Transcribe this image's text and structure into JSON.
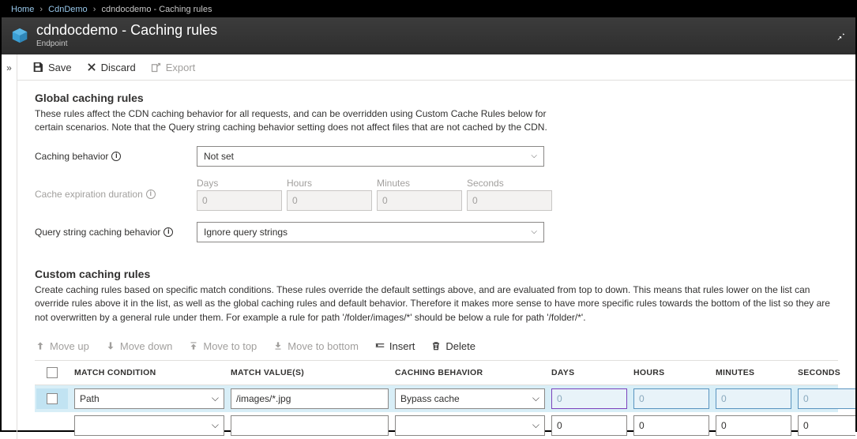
{
  "breadcrumb": {
    "home": "Home",
    "profile": "CdnDemo",
    "current": "cdndocdemo - Caching rules"
  },
  "header": {
    "title": "cdndocdemo - Caching rules",
    "subtitle": "Endpoint"
  },
  "toolbar": {
    "save": "Save",
    "discard": "Discard",
    "export": "Export"
  },
  "global": {
    "heading": "Global caching rules",
    "desc": "These rules affect the CDN caching behavior for all requests, and can be overridden using Custom Cache Rules below for certain scenarios. Note that the Query string caching behavior setting does not affect files that are not cached by the CDN.",
    "caching_label": "Caching behavior",
    "caching_value": "Not set",
    "duration_label": "Cache expiration duration",
    "d_days": "Days",
    "d_hours": "Hours",
    "d_minutes": "Minutes",
    "d_seconds": "Seconds",
    "d_days_v": "0",
    "d_hours_v": "0",
    "d_minutes_v": "0",
    "d_seconds_v": "0",
    "query_label": "Query string caching behavior",
    "query_value": "Ignore query strings"
  },
  "custom": {
    "heading": "Custom caching rules",
    "desc": "Create caching rules based on specific match conditions. These rules override the default settings above, and are evaluated from top to down. This means that rules lower on the list can override rules above it in the list, as well as the global caching rules and default behavior. Therefore it makes more sense to have more specific rules towards the bottom of the list so they are not overwritten by a general rule under them. For example a rule for path '/folder/images/*' should be below a rule for path '/folder/*'.",
    "btn_moveup": "Move up",
    "btn_movedown": "Move down",
    "btn_movetop": "Move to top",
    "btn_movebottom": "Move to bottom",
    "btn_insert": "Insert",
    "btn_delete": "Delete",
    "col_match": "MATCH CONDITION",
    "col_value": "MATCH VALUE(S)",
    "col_behavior": "CACHING BEHAVIOR",
    "col_days": "DAYS",
    "col_hours": "HOURS",
    "col_minutes": "MINUTES",
    "col_seconds": "SECONDS",
    "rows": [
      {
        "match": "Path",
        "value": "/images/*.jpg",
        "behavior": "Bypass cache",
        "d": "0",
        "h": "0",
        "m": "0",
        "s": "0",
        "selected": true,
        "num_disabled": true
      },
      {
        "match": "",
        "value": "",
        "behavior": "",
        "d": "0",
        "h": "0",
        "m": "0",
        "s": "0",
        "selected": false,
        "num_disabled": false
      }
    ]
  }
}
